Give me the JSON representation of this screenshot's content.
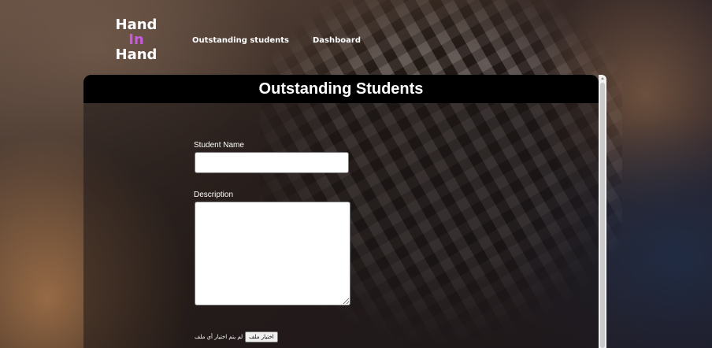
{
  "header": {
    "logo": {
      "line1": "Hand",
      "line2": "In",
      "line3": "Hand"
    },
    "nav": [
      {
        "label": "Outstanding students"
      },
      {
        "label": "Dashboard"
      }
    ]
  },
  "form": {
    "title": "Outstanding Students",
    "student_name_label": "Student Name",
    "student_name_value": "",
    "description_label": "Description",
    "description_value": "",
    "file_button_label": "اختيار ملف",
    "file_status": "لم يتم اختيار أي ملف"
  },
  "colors": {
    "logo_accent": "#c55bd9",
    "header_bar": "#000000"
  }
}
